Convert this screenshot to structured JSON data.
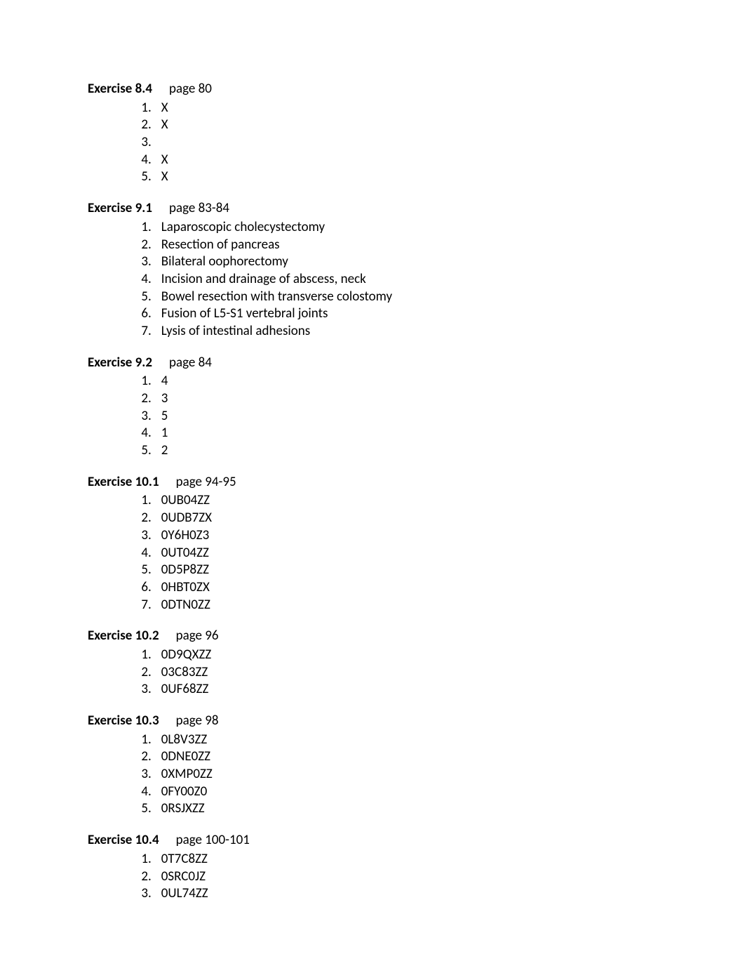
{
  "exercises": [
    {
      "title": "Exercise 8.4",
      "page": "page 80",
      "items": [
        "X",
        "X",
        "",
        "X",
        "X"
      ]
    },
    {
      "title": "Exercise 9.1",
      "page": "page 83-84",
      "items": [
        "Laparoscopic cholecystectomy",
        "Resection of pancreas",
        "Bilateral oophorectomy",
        "Incision and drainage of abscess, neck",
        "Bowel resection with transverse colostomy",
        "Fusion of L5-S1 vertebral joints",
        "Lysis of intestinal adhesions"
      ]
    },
    {
      "title": "Exercise 9.2",
      "page": "page 84",
      "items": [
        "4",
        "3",
        "5",
        "1",
        "2"
      ]
    },
    {
      "title": "Exercise 10.1",
      "page": "page 94-95",
      "items": [
        "0UB04ZZ",
        "0UDB7ZX",
        "0Y6H0Z3",
        "0UT04ZZ",
        "0D5P8ZZ",
        "0HBT0ZX",
        "0DTN0ZZ"
      ]
    },
    {
      "title": "Exercise 10.2",
      "page": "page 96",
      "items": [
        "0D9QXZZ",
        "03C83ZZ",
        "0UF68ZZ"
      ]
    },
    {
      "title": "Exercise 10.3",
      "page": "page 98",
      "items": [
        "0L8V3ZZ",
        "0DNE0ZZ",
        "0XMP0ZZ",
        "0FY00Z0",
        "0RSJXZZ"
      ]
    },
    {
      "title": "Exercise 10.4",
      "page": "page 100-101",
      "items": [
        "0T7C8ZZ",
        "0SRC0JZ",
        "0UL74ZZ"
      ]
    }
  ]
}
